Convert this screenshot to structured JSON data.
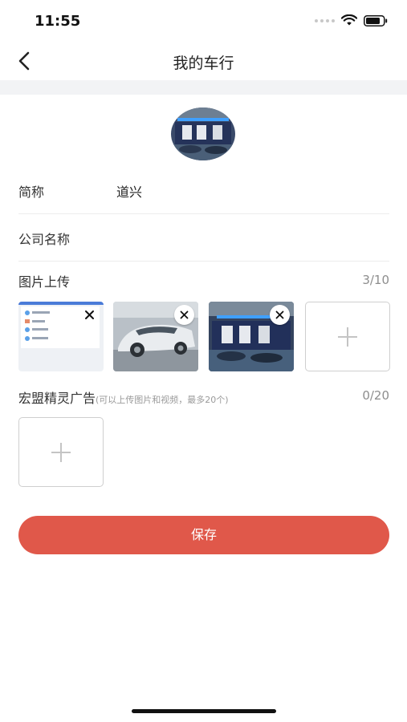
{
  "status": {
    "time": "11:55"
  },
  "nav": {
    "title": "我的车行",
    "back_icon": "chevron-left-icon"
  },
  "form": {
    "short_name": {
      "label": "简称",
      "value": "道兴"
    },
    "company_name": {
      "label": "公司名称",
      "value": ""
    }
  },
  "images": {
    "title": "图片上传",
    "count": "3/10",
    "items": [
      {
        "name": "app-screenshot",
        "deletable": true
      },
      {
        "name": "car-showroom-white-porsche",
        "deletable": true
      },
      {
        "name": "garage-interior",
        "deletable": true
      }
    ]
  },
  "ads": {
    "title": "宏盟精灵广告",
    "hint": "(可以上传图片和视频，最多20个)",
    "count": "0/20"
  },
  "actions": {
    "save": "保存"
  },
  "colors": {
    "accent": "#e0584a",
    "divider": "#ececec",
    "band": "#f2f3f5"
  }
}
